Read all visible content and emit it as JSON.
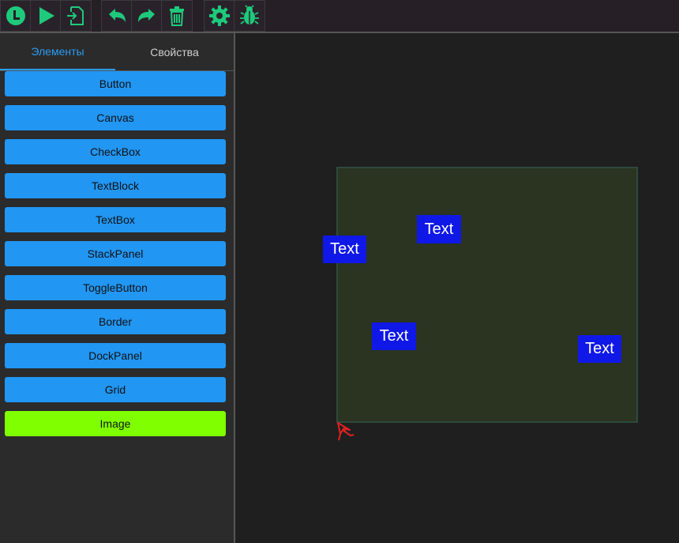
{
  "toolbar": {
    "groups": [
      {
        "buttons": [
          {
            "name": "logo-icon",
            "color": "#1ec97c"
          },
          {
            "name": "play-icon",
            "color": "#1ec97c"
          },
          {
            "name": "export-icon",
            "color": "#1ec97c"
          }
        ]
      },
      {
        "buttons": [
          {
            "name": "undo-icon",
            "color": "#1ec97c"
          },
          {
            "name": "redo-icon",
            "color": "#1ec97c"
          },
          {
            "name": "trash-icon",
            "color": "#1ec97c"
          }
        ]
      },
      {
        "buttons": [
          {
            "name": "gear-icon",
            "color": "#1ec97c"
          },
          {
            "name": "bug-icon",
            "color": "#1ec97c"
          }
        ]
      }
    ]
  },
  "tabs": {
    "elements": "Элементы",
    "properties": "Свойства",
    "active": "elements"
  },
  "elements": [
    {
      "label": "Button"
    },
    {
      "label": "Canvas"
    },
    {
      "label": "CheckBox"
    },
    {
      "label": "TextBlock"
    },
    {
      "label": "TextBox"
    },
    {
      "label": "StackPanel"
    },
    {
      "label": "ToggleButton"
    },
    {
      "label": "Border"
    },
    {
      "label": "DockPanel"
    },
    {
      "label": "Grid"
    },
    {
      "label": "Image",
      "selected": true
    }
  ],
  "canvas": {
    "text_items": [
      {
        "label": "Text"
      },
      {
        "label": "Text"
      },
      {
        "label": "Text"
      },
      {
        "label": "Text"
      }
    ]
  },
  "colors": {
    "accent": "#2196f3",
    "selected": "#7fff00",
    "icon": "#1ec97c",
    "text_element": "#0f18e6",
    "canvas": "#2a3420"
  },
  "cursor": {
    "icon": "pointer-cursor-icon",
    "color": "#e02020"
  }
}
